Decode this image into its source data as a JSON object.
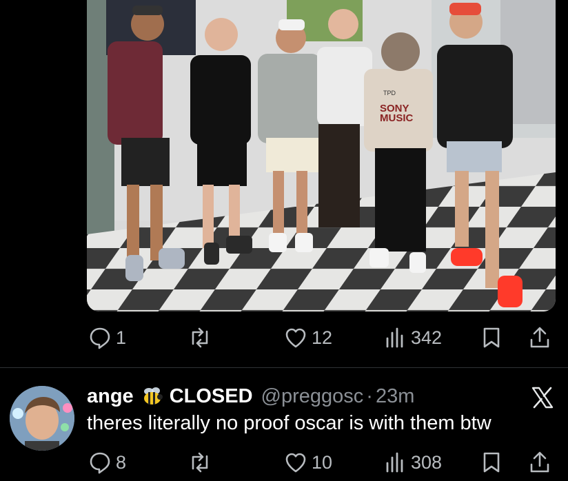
{
  "post": {
    "stats": {
      "replies": "1",
      "reposts": "",
      "likes": "12",
      "views": "342"
    },
    "photo": {
      "sign_text": "TPD",
      "shirt_text_1": "SONY",
      "shirt_text_2": "MUSIC"
    }
  },
  "reply": {
    "name": "ange",
    "emoji": "bee",
    "flair": "CLOSED",
    "handle": "@preggosc",
    "separator": "·",
    "time": "23m",
    "text": "theres literally no proof oscar is with them btw",
    "stats": {
      "replies": "8",
      "reposts": "",
      "likes": "10",
      "views": "308"
    }
  },
  "colors": {
    "background": "#000000",
    "icon": "#b8bcc0",
    "secondary_text": "#8b9096",
    "divider": "#2f3336"
  },
  "icons": [
    "reply-icon",
    "repost-icon",
    "like-icon",
    "views-icon",
    "bookmark-icon",
    "share-icon",
    "x-logo-icon",
    "bee-emoji-icon"
  ]
}
